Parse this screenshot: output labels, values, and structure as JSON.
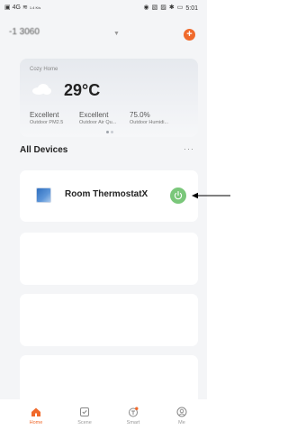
{
  "status_bar": {
    "network": "4G",
    "speed": "1.4 K/s",
    "time": "5:01"
  },
  "header": {
    "home_name": "-1  3060",
    "add_label": "+"
  },
  "weather": {
    "home_label": "Cozy Home",
    "temperature": "29°C",
    "metrics": [
      {
        "value": "Excellent",
        "label": "Outdoor PM2.5"
      },
      {
        "value": "Excellent",
        "label": "Outdoor Air Qu..."
      },
      {
        "value": "75.0%",
        "label": "Outdoor Humidi..."
      }
    ]
  },
  "devices": {
    "title": "All Devices",
    "more_label": "···",
    "items": [
      {
        "name": "Room ThermostatX",
        "icon": "thermostat-icon",
        "power": "on"
      }
    ]
  },
  "bottom_nav": {
    "items": [
      {
        "label": "Home",
        "icon": "home-icon",
        "active": true
      },
      {
        "label": "Scene",
        "icon": "scene-icon",
        "active": false
      },
      {
        "label": "Smart",
        "icon": "smart-icon",
        "active": false
      },
      {
        "label": "Me",
        "icon": "me-icon",
        "active": false
      }
    ]
  },
  "colors": {
    "accent": "#f06a2c",
    "power_on": "#7ac77a"
  }
}
